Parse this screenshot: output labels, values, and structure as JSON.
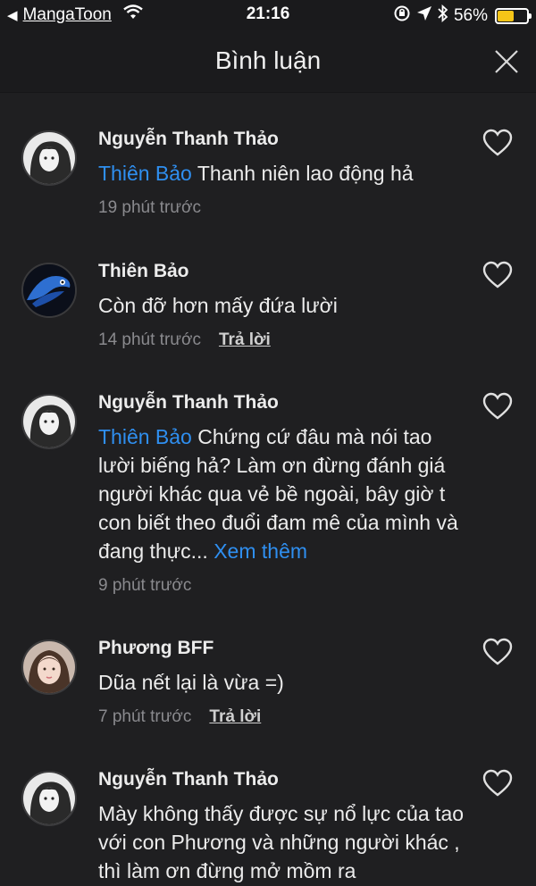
{
  "status_bar": {
    "back_app": "MangaToon",
    "time": "21:16",
    "battery_percent": "56%",
    "battery_level": 0.56
  },
  "header": {
    "title": "Bình luận"
  },
  "comments": [
    {
      "author": "Nguyễn Thanh Thảo",
      "mention": "Thiên Bảo",
      "text": " Thanh niên lao động hả",
      "time": "19 phút trước",
      "reply": "",
      "more": ""
    },
    {
      "author": "Thiên Bảo",
      "mention": "",
      "text": "Còn đỡ hơn mấy đứa lười",
      "time": "14 phút trước",
      "reply": "Trả lời",
      "more": ""
    },
    {
      "author": "Nguyễn Thanh Thảo",
      "mention": "Thiên Bảo",
      "text": " Chứng cứ đâu mà nói tao lười biếng hả? Làm ơn đừng đánh giá người khác qua vẻ bề ngoài, bây giờ t con biết theo đuổi đam mê của mình và đang thực... ",
      "time": "9 phút trước",
      "reply": "",
      "more": "Xem thêm"
    },
    {
      "author": "Phương BFF",
      "mention": "",
      "text": "Dũa nết lại là vừa =)",
      "time": "7 phút trước",
      "reply": "Trả lời",
      "more": ""
    },
    {
      "author": "Nguyễn Thanh Thảo",
      "mention": "",
      "text": "Mày không thấy được sự nổ lực của tao với con Phương và những người khác , thì làm ơn đừng mở mồm ra",
      "time": "",
      "reply": "",
      "more": ""
    }
  ],
  "colors": {
    "background": "#1f1f21",
    "mention": "#2f8ff0",
    "meta": "#8a8a8e",
    "battery": "#f5c518"
  }
}
